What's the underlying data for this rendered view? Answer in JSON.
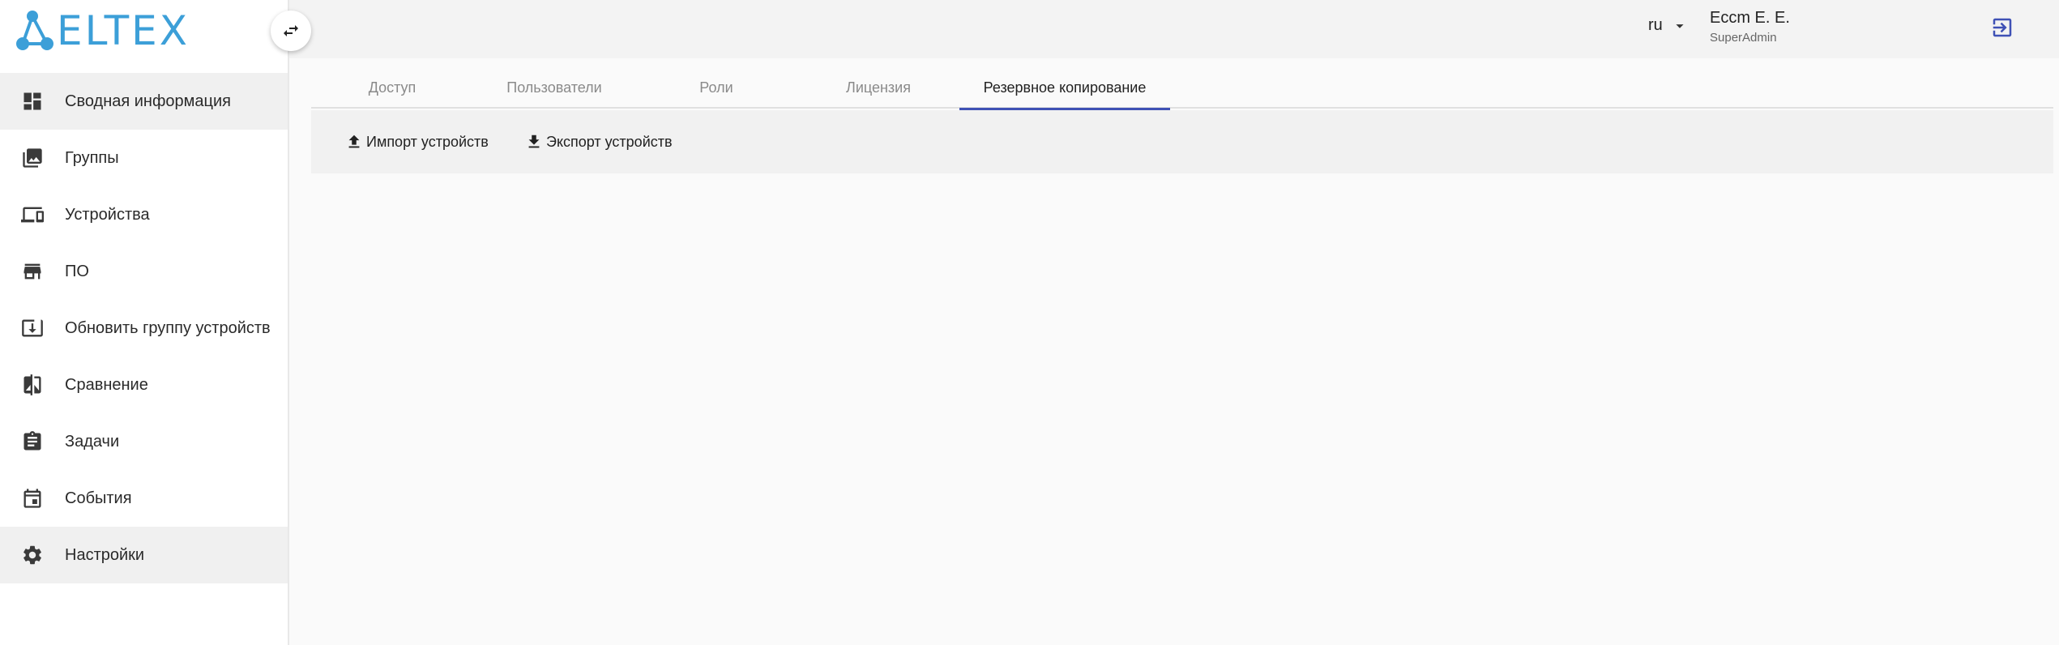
{
  "brand": {
    "logo_text": "ELTEX",
    "color": "#3c9fd8"
  },
  "sidebar": {
    "toggle_icon": "swap-horizontal-icon",
    "items": [
      {
        "label": "Сводная информация",
        "icon": "dashboard-icon",
        "active": true
      },
      {
        "label": "Группы",
        "icon": "photo-library-icon",
        "active": false
      },
      {
        "label": "Устройства",
        "icon": "devices-icon",
        "active": false
      },
      {
        "label": "ПО",
        "icon": "store-icon",
        "active": false
      },
      {
        "label": "Обновить группу устройств",
        "icon": "system-update-icon",
        "active": false
      },
      {
        "label": "Сравнение",
        "icon": "compare-icon",
        "active": false
      },
      {
        "label": "Задачи",
        "icon": "assignment-icon",
        "active": false
      },
      {
        "label": "События",
        "icon": "event-icon",
        "active": false
      },
      {
        "label": "Настройки",
        "icon": "settings-icon",
        "active": true
      }
    ]
  },
  "header": {
    "language": "ru",
    "user_name": "Eccm E. E.",
    "user_role": "SuperAdmin",
    "logout_icon": "logout-icon",
    "accent": "#3f51b5"
  },
  "tabs": [
    {
      "label": "Доступ",
      "active": false
    },
    {
      "label": "Пользователи",
      "active": false
    },
    {
      "label": "Роли",
      "active": false
    },
    {
      "label": "Лицензия",
      "active": false
    },
    {
      "label": "Резервное копирование",
      "active": true
    }
  ],
  "toolbar": {
    "import_label": "Импорт устройств",
    "export_label": "Экспорт устройств"
  }
}
